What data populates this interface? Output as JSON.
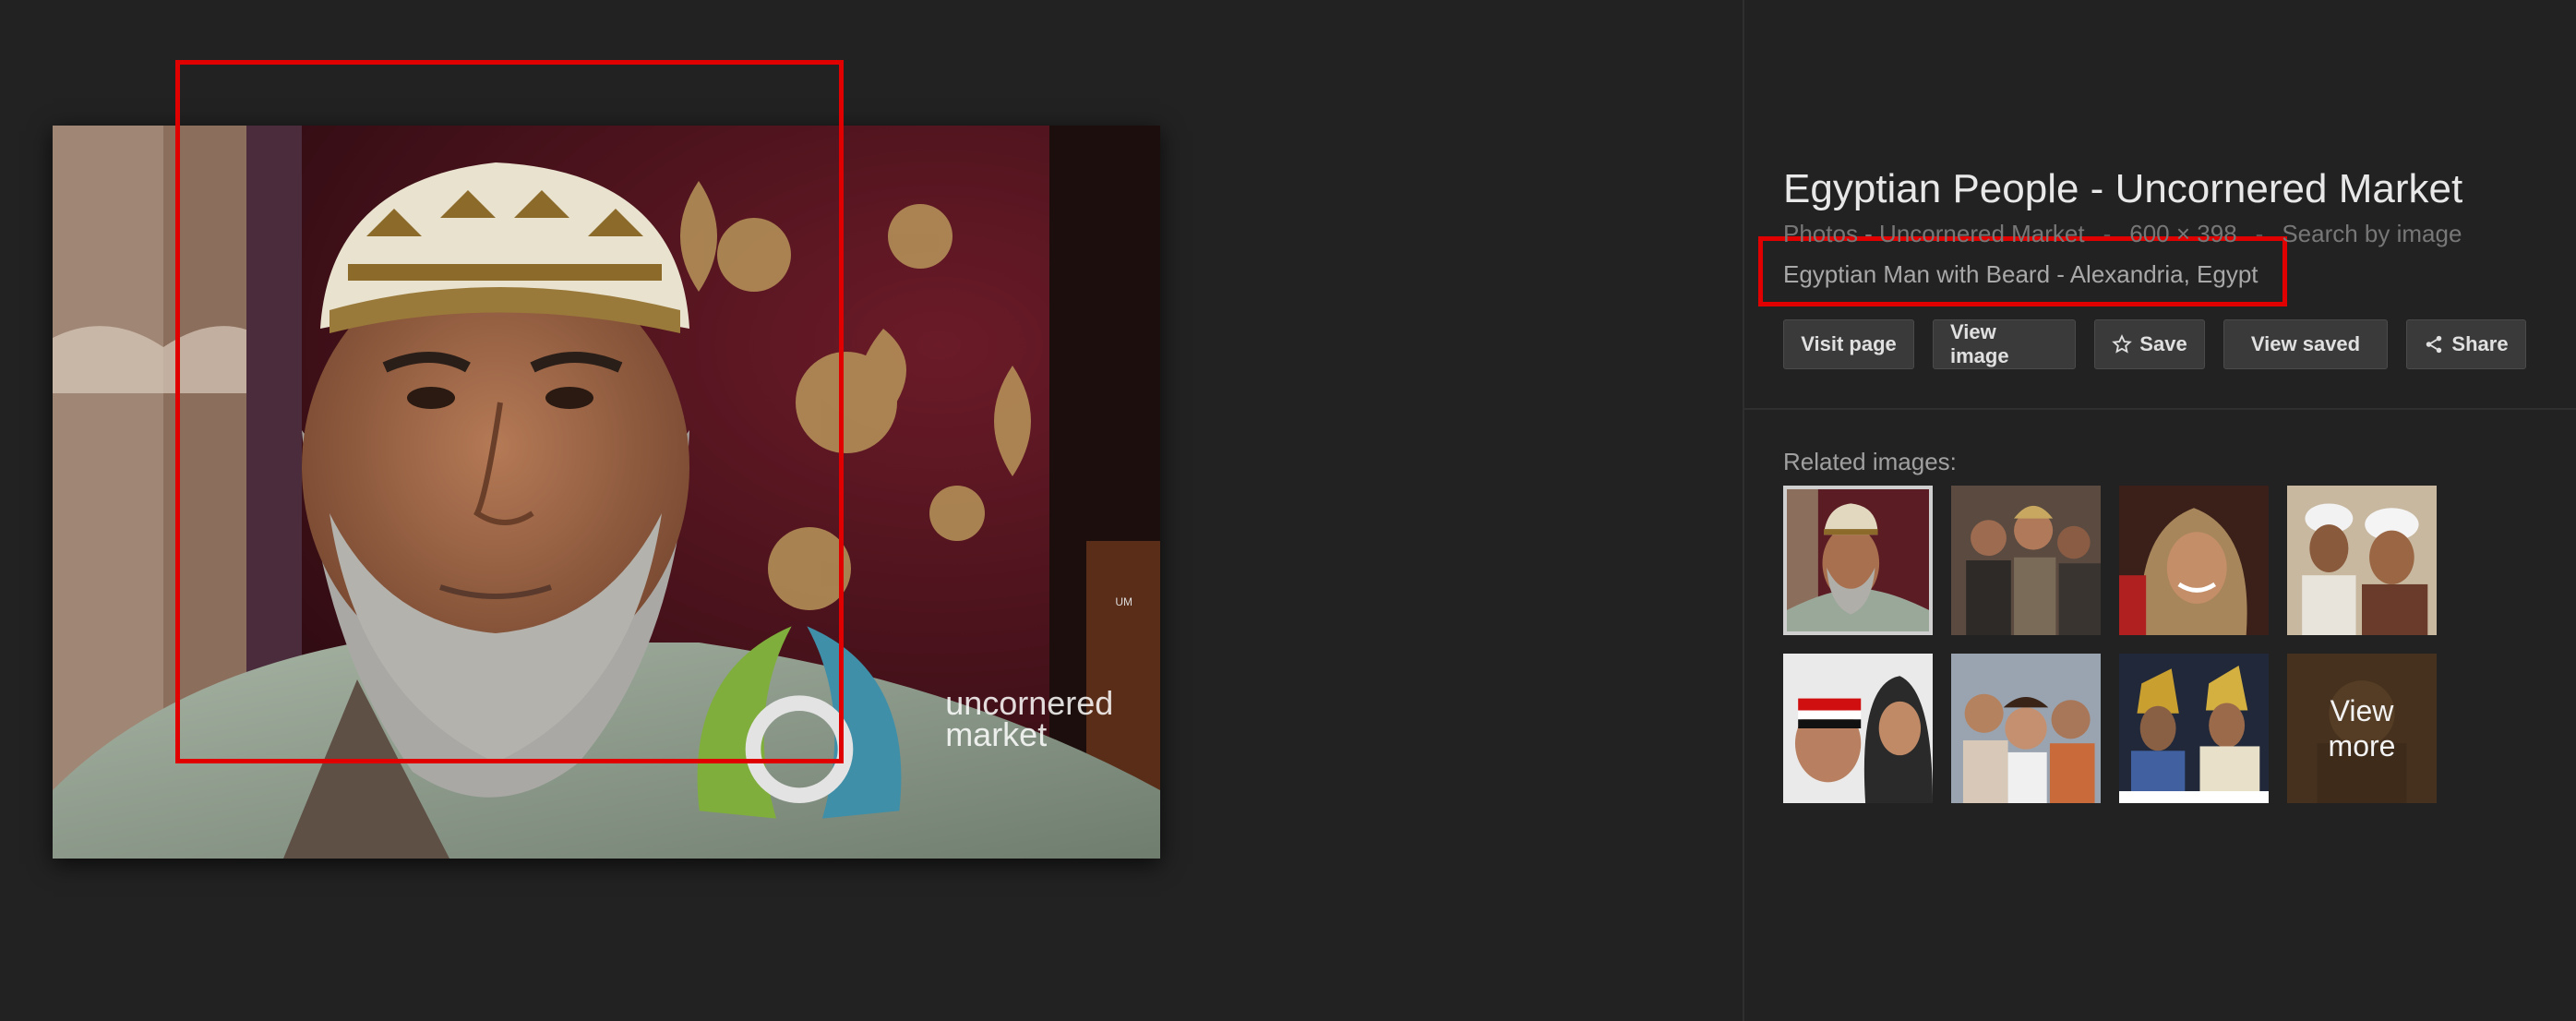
{
  "image_viewer": {
    "title": "Egyptian People - Uncornered Market",
    "meta": {
      "source": "Photos - Uncornered Market",
      "dimensions": "600 × 398",
      "search_link": "Search by image"
    },
    "caption": "Egyptian Man with Beard - Alexandria, Egypt",
    "watermark": {
      "line1": "uncornered",
      "line2": "market",
      "mark": "UM"
    },
    "actions": {
      "visit_page": "Visit page",
      "view_image": "View image",
      "save": "Save",
      "view_saved": "View saved",
      "share": "Share"
    },
    "related": {
      "label": "Related images:",
      "view_more_line1": "View",
      "view_more_line2": "more",
      "thumbs": [
        "man-with-beard",
        "group-people",
        "woman-headscarf",
        "men-turbans",
        "children-flag",
        "girls-smiling",
        "pharaoh-costumes",
        "view-more"
      ]
    }
  },
  "annotations": {
    "color": "#e00000"
  },
  "colors": {
    "background": "#222222",
    "button": "#3a3a3a",
    "text": "#e8e8e8"
  }
}
